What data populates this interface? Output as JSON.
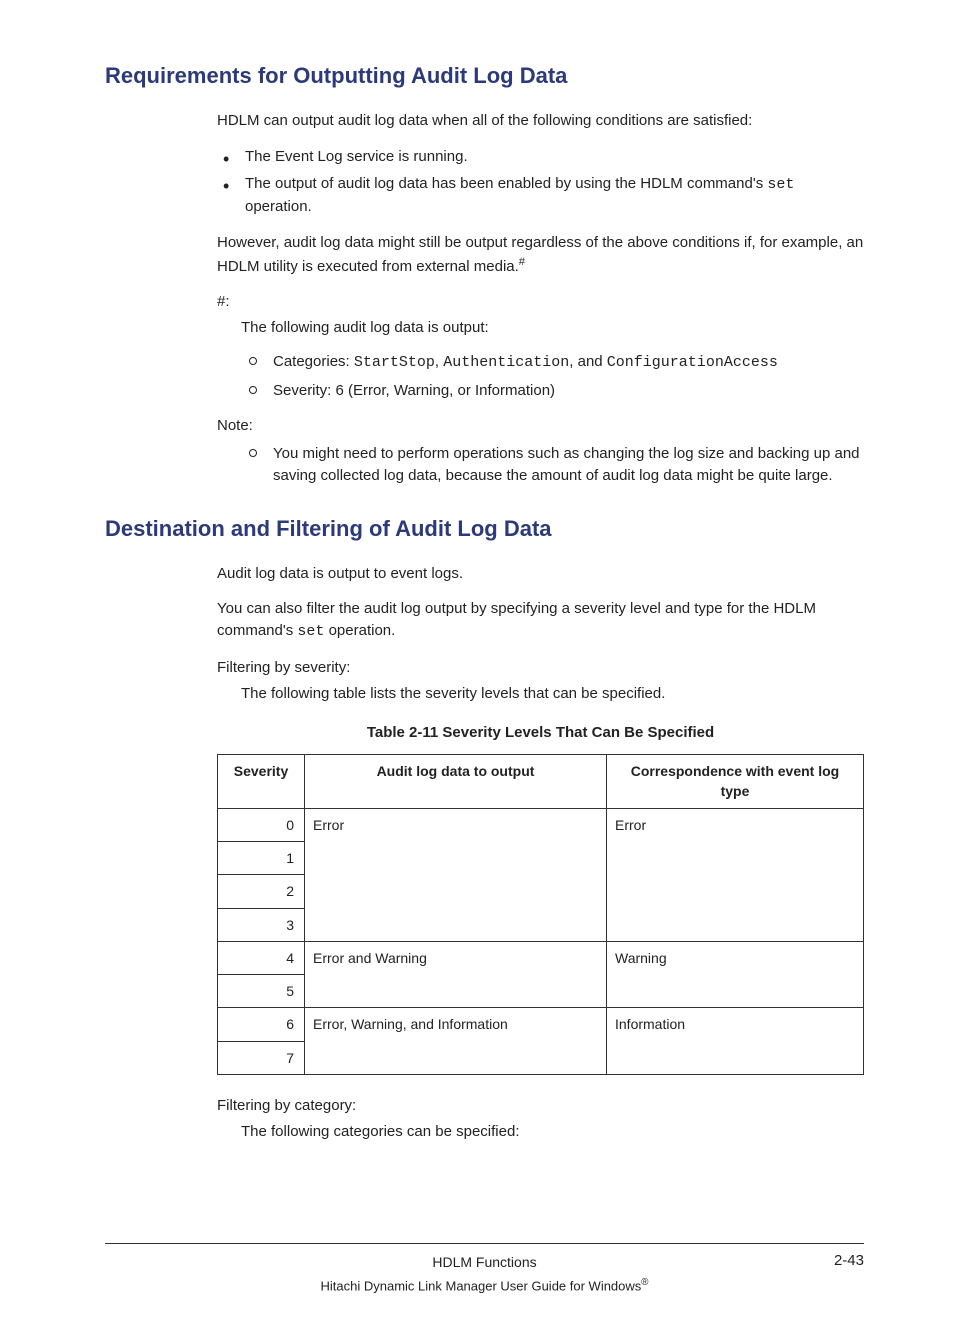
{
  "section1": {
    "title": "Requirements for Outputting Audit Log Data",
    "p1": "HDLM can output audit log data when all of the following conditions are satisfied:",
    "b1": "The Event Log service is running.",
    "b2a": "The output of audit log data has been enabled by using the HDLM command's ",
    "b2code": "set",
    "b2b": " operation.",
    "p2a": "However, audit log data might still be output regardless of the above conditions if, for example, an HDLM utility is executed from external media.",
    "p2sup": "#",
    "hash": "#:",
    "hash_body": "The following audit log data is output:",
    "c1a": "Categories: ",
    "c1code1": "StartStop",
    "c1mid1": ", ",
    "c1code2": "Authentication",
    "c1mid2": ", and ",
    "c1code3": "ConfigurationAccess",
    "c2": "Severity: 6 (Error, Warning, or Information)",
    "note": "Note:",
    "note_b1": "You might need to perform operations such as changing the log size and backing up and saving collected log data, because the amount of audit log data might be quite large."
  },
  "section2": {
    "title": "Destination and Filtering of Audit Log Data",
    "p1": "Audit log data is output to event logs.",
    "p2a": "You can also filter the audit log output by specifying a severity level and type for the HDLM command's ",
    "p2code": "set",
    "p2b": " operation.",
    "filt_sev": "Filtering by severity:",
    "filt_sev_body": "The following table lists the severity levels that can be specified.",
    "table_caption": "Table 2-11 Severity Levels That Can Be Specified",
    "th1": "Severity",
    "th2": "Audit log data to output",
    "th3": "Correspondence with event log type",
    "filt_cat": "Filtering by category:",
    "filt_cat_body": "The following categories can be specified:"
  },
  "chart_data": {
    "type": "table",
    "title": "Table 2-11 Severity Levels That Can Be Specified",
    "columns": [
      "Severity",
      "Audit log data to output",
      "Correspondence with event log type"
    ],
    "rows": [
      {
        "severity": 0,
        "output": "Error",
        "event_log_type": "Error"
      },
      {
        "severity": 1,
        "output": "Error",
        "event_log_type": "Error"
      },
      {
        "severity": 2,
        "output": "Error",
        "event_log_type": "Error"
      },
      {
        "severity": 3,
        "output": "Error",
        "event_log_type": "Error"
      },
      {
        "severity": 4,
        "output": "Error and Warning",
        "event_log_type": "Warning"
      },
      {
        "severity": 5,
        "output": "Error and Warning",
        "event_log_type": "Warning"
      },
      {
        "severity": 6,
        "output": "Error, Warning, and Information",
        "event_log_type": "Information"
      },
      {
        "severity": 7,
        "output": "Error, Warning, and Information",
        "event_log_type": "Information"
      }
    ]
  },
  "footer": {
    "f1": "HDLM Functions",
    "page": "2-43",
    "f2a": "Hitachi Dynamic Link Manager User Guide for Windows",
    "f2sup": "®"
  }
}
